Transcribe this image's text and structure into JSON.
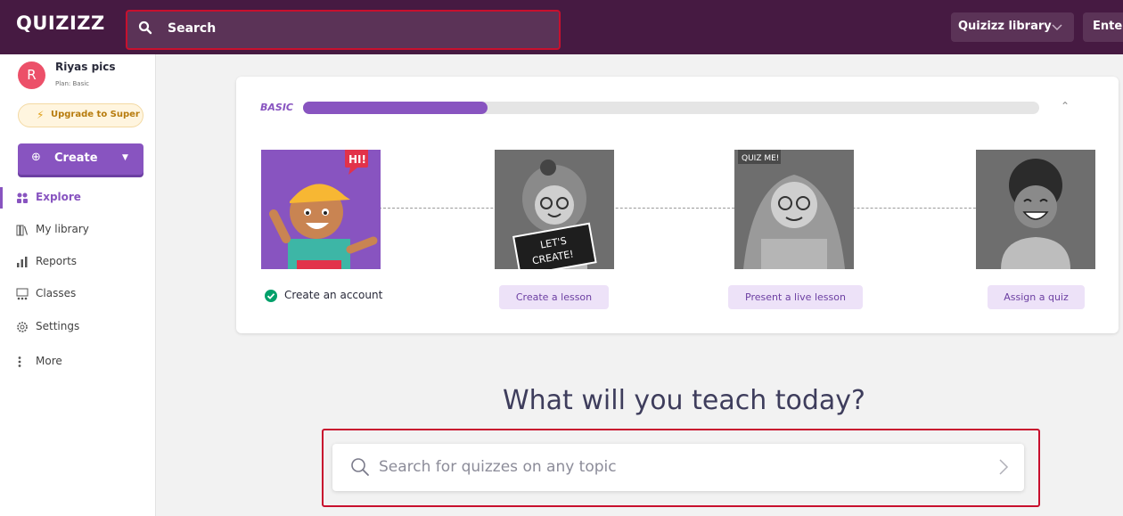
{
  "header": {
    "logo": "QUIZIZZ",
    "search_label": "Search",
    "library_label": "Quizizz library",
    "enter_label": "Enter"
  },
  "user": {
    "initial": "R",
    "name": "Riyas pics",
    "plan": "Plan: Basic",
    "upgrade_label": "Upgrade to Super",
    "create_label": "Create"
  },
  "sidebar": {
    "items": [
      {
        "label": "Explore",
        "icon": "explore-icon",
        "active": true
      },
      {
        "label": "My library",
        "icon": "library-icon",
        "active": false
      },
      {
        "label": "Reports",
        "icon": "reports-icon",
        "active": false
      },
      {
        "label": "Classes",
        "icon": "classes-icon",
        "active": false
      },
      {
        "label": "Settings",
        "icon": "settings-icon",
        "active": false
      },
      {
        "label": "More",
        "icon": "more-icon",
        "active": false
      }
    ]
  },
  "onboarding": {
    "plan_label": "BASIC",
    "progress_fraction": 0.25,
    "steps": [
      {
        "label": "Create an account",
        "completed": true,
        "badge": "HI!"
      },
      {
        "label": "Create a lesson",
        "completed": false,
        "badge": "LET'S CREATE!"
      },
      {
        "label": "Present a live lesson",
        "completed": false,
        "badge": "QUIZ ME!"
      },
      {
        "label": "Assign a quiz",
        "completed": false,
        "badge": ""
      }
    ]
  },
  "main": {
    "headline": "What will you teach today?",
    "search_placeholder": "Search for quizzes on any topic"
  },
  "colors": {
    "topbar": "#461a42",
    "accent": "#8854c0",
    "highlight_border": "#c8102e",
    "check": "#00a06a"
  }
}
